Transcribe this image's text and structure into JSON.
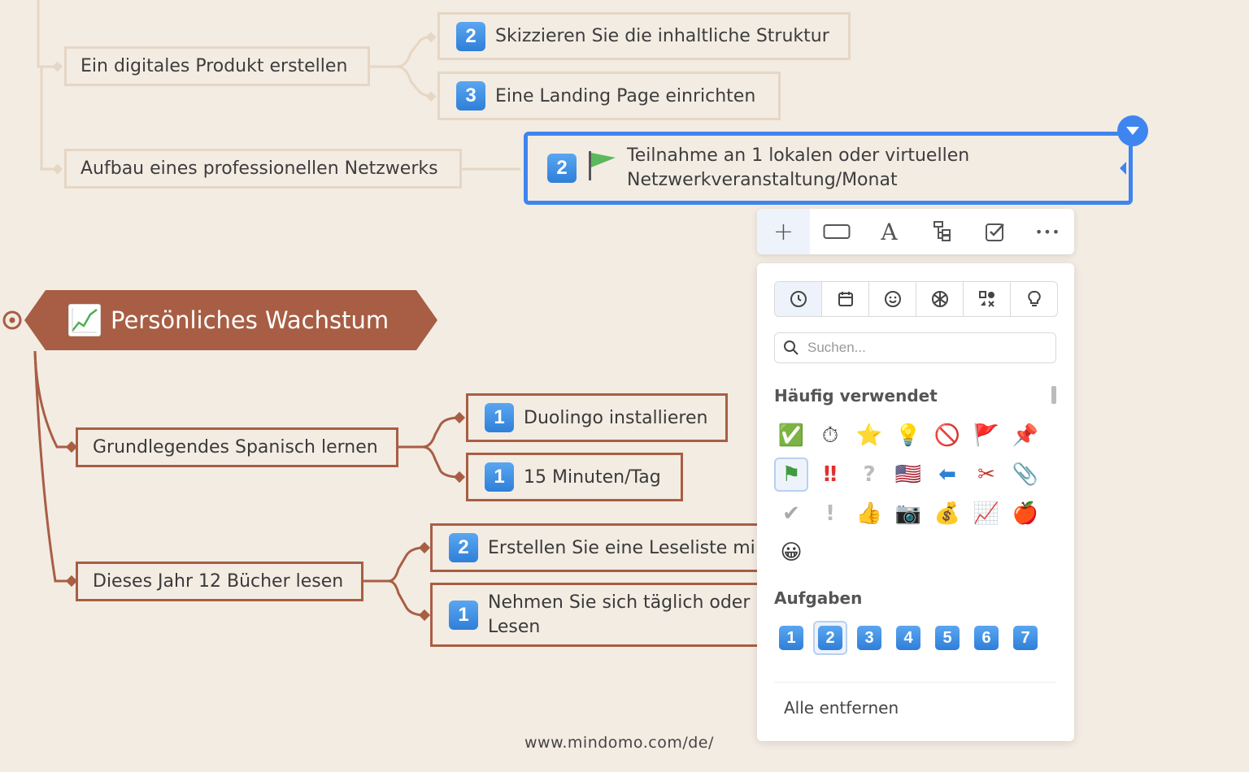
{
  "map": {
    "upper_branches": [
      {
        "label": "Ein digitales Produkt erstellen"
      },
      {
        "label": "Aufbau eines professionellen Netzwerks"
      }
    ],
    "upper_subtasks": [
      {
        "badge": "2",
        "label": "Skizzieren Sie die inhaltliche Struktur"
      },
      {
        "badge": "3",
        "label": "Eine Landing Page einrichten"
      }
    ],
    "selected_topic": {
      "badge": "2",
      "icon": "green-flag-icon",
      "label": "Teilnahme an 1 lokalen oder virtuellen\nNetzwerkveranstaltung/Monat"
    },
    "root": {
      "icon": "chart-increasing-icon",
      "label": "Persönliches Wachstum"
    },
    "lower_branches": [
      {
        "label": "Grundlegendes Spanisch lernen"
      },
      {
        "label": "Dieses Jahr 12 Bücher lesen"
      }
    ],
    "lower_subtasks": [
      {
        "badge": "1",
        "label": "Duolingo installieren"
      },
      {
        "badge": "1",
        "label": "15 Minuten/Tag"
      },
      {
        "badge": "2",
        "label": "Erstellen Sie eine Leseliste mi"
      },
      {
        "badge": "1",
        "label": "Nehmen Sie sich täglich oder\nLesen"
      }
    ],
    "colors": {
      "background": "#f3ece3",
      "brand_brown": "#a85e44",
      "selection_blue": "#3f85f0",
      "badge_blue": "#2f7fd9"
    }
  },
  "toolbar": {
    "items": [
      {
        "name": "add-icon",
        "glyph": "+"
      },
      {
        "name": "shape-icon",
        "glyph": "▭"
      },
      {
        "name": "text-style-icon",
        "glyph": "A"
      },
      {
        "name": "layout-tree-icon",
        "glyph": "⊢"
      },
      {
        "name": "task-checkbox-icon",
        "glyph": "☑"
      },
      {
        "name": "more-icon",
        "glyph": "•••"
      }
    ]
  },
  "icon_panel": {
    "category_tabs": [
      {
        "name": "recent-clock-icon",
        "glyph": "🕓"
      },
      {
        "name": "calendar-icon",
        "glyph": "📅"
      },
      {
        "name": "smiley-icon",
        "glyph": "☺"
      },
      {
        "name": "sports-ball-icon",
        "glyph": "⚽"
      },
      {
        "name": "symbols-icon",
        "glyph": "⌘"
      },
      {
        "name": "lightbulb-icon",
        "glyph": "💡"
      }
    ],
    "search_placeholder": "Suchen...",
    "frequently_used_title": "Häufig verwendet",
    "frequently_used": [
      {
        "name": "check-mark-icon",
        "glyph": "✅"
      },
      {
        "name": "stopwatch-icon",
        "glyph": "⏱"
      },
      {
        "name": "star-icon",
        "glyph": "⭐"
      },
      {
        "name": "lightbulb-icon",
        "glyph": "💡"
      },
      {
        "name": "prohibited-icon",
        "glyph": "🚫"
      },
      {
        "name": "red-flag-icon",
        "glyph": "🚩"
      },
      {
        "name": "pushpin-icon",
        "glyph": "📌"
      },
      {
        "name": "green-flag-icon",
        "glyph": "⚑"
      },
      {
        "name": "double-exclamation-icon",
        "glyph": "‼"
      },
      {
        "name": "question-mark-icon",
        "glyph": "?"
      },
      {
        "name": "us-flag-icon",
        "glyph": "🇺🇸"
      },
      {
        "name": "left-arrow-icon",
        "glyph": "⬅"
      },
      {
        "name": "scissors-icon",
        "glyph": "✂"
      },
      {
        "name": "paperclip-icon",
        "glyph": "📎"
      },
      {
        "name": "grey-check-icon",
        "glyph": "✔"
      },
      {
        "name": "grey-exclamation-icon",
        "glyph": "!"
      },
      {
        "name": "thumbs-up-icon",
        "glyph": "👍"
      },
      {
        "name": "camera-icon",
        "glyph": "📷"
      },
      {
        "name": "money-bag-icon",
        "glyph": "💰"
      },
      {
        "name": "chart-increasing-icon",
        "glyph": "📈"
      },
      {
        "name": "apple-icon",
        "glyph": "🍎"
      },
      {
        "name": "grinning-face-icon",
        "glyph": "😀"
      }
    ],
    "tasks_title": "Aufgaben",
    "tasks": [
      "1",
      "2",
      "3",
      "4",
      "5",
      "6",
      "7"
    ],
    "remove_all_label": "Alle entfernen"
  },
  "footer": {
    "url": "www.mindomo.com/de/"
  }
}
